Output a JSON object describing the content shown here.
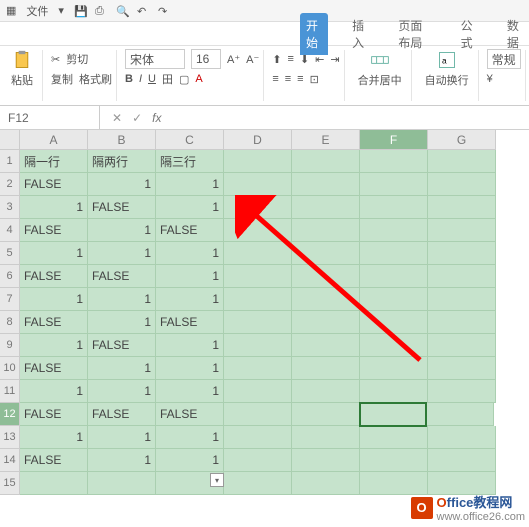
{
  "titlebar": {
    "file_label": "文件"
  },
  "tabs": {
    "start": "开始",
    "insert": "插入",
    "layout": "页面布局",
    "formula": "公式",
    "data": "数据"
  },
  "ribbon": {
    "cut": "剪切",
    "copy": "复制",
    "format_painter": "格式刷",
    "paste": "粘贴",
    "font_name": "宋体",
    "font_size": "16",
    "merge": "合并居中",
    "wrap": "自动换行",
    "general": "常规"
  },
  "namebox": {
    "ref": "F12"
  },
  "columns": [
    "A",
    "B",
    "C",
    "D",
    "E",
    "F",
    "G"
  ],
  "rows": [
    {
      "n": "1",
      "A": "隔一行",
      "B": "隔两行",
      "C": "隔三行",
      "D": "",
      "Aa": "left",
      "Ba": "left",
      "Ca": "left"
    },
    {
      "n": "2",
      "A": "FALSE",
      "B": "1",
      "C": "1",
      "D": "",
      "Aa": "left",
      "Ba": "right",
      "Ca": "right"
    },
    {
      "n": "3",
      "A": "1",
      "B": "FALSE",
      "C": "1",
      "D": "",
      "Aa": "right",
      "Ba": "left",
      "Ca": "right"
    },
    {
      "n": "4",
      "A": "FALSE",
      "B": "1",
      "C": "FALSE",
      "D": "",
      "Aa": "left",
      "Ba": "right",
      "Ca": "left"
    },
    {
      "n": "5",
      "A": "1",
      "B": "1",
      "C": "1",
      "D": "",
      "Aa": "right",
      "Ba": "right",
      "Ca": "right"
    },
    {
      "n": "6",
      "A": "FALSE",
      "B": "FALSE",
      "C": "1",
      "D": "",
      "Aa": "left",
      "Ba": "left",
      "Ca": "right"
    },
    {
      "n": "7",
      "A": "1",
      "B": "1",
      "C": "1",
      "D": "",
      "Aa": "right",
      "Ba": "right",
      "Ca": "right"
    },
    {
      "n": "8",
      "A": "FALSE",
      "B": "1",
      "C": "FALSE",
      "D": "",
      "Aa": "left",
      "Ba": "right",
      "Ca": "left"
    },
    {
      "n": "9",
      "A": "1",
      "B": "FALSE",
      "C": "1",
      "D": "",
      "Aa": "right",
      "Ba": "left",
      "Ca": "right"
    },
    {
      "n": "10",
      "A": "FALSE",
      "B": "1",
      "C": "1",
      "D": "",
      "Aa": "left",
      "Ba": "right",
      "Ca": "right"
    },
    {
      "n": "11",
      "A": "1",
      "B": "1",
      "C": "1",
      "D": "",
      "Aa": "right",
      "Ba": "right",
      "Ca": "right"
    },
    {
      "n": "12",
      "A": "FALSE",
      "B": "FALSE",
      "C": "FALSE",
      "D": "",
      "Aa": "left",
      "Ba": "left",
      "Ca": "left"
    },
    {
      "n": "13",
      "A": "1",
      "B": "1",
      "C": "1",
      "D": "",
      "Aa": "right",
      "Ba": "right",
      "Ca": "right"
    },
    {
      "n": "14",
      "A": "FALSE",
      "B": "1",
      "C": "1",
      "D": "",
      "Aa": "left",
      "Ba": "right",
      "Ca": "right"
    },
    {
      "n": "15",
      "A": "",
      "B": "",
      "C": "",
      "D": "",
      "Aa": "left",
      "Ba": "left",
      "Ca": "left"
    }
  ],
  "watermark": {
    "brand_rest": "ffice教程网",
    "url": "www.office26.com"
  }
}
